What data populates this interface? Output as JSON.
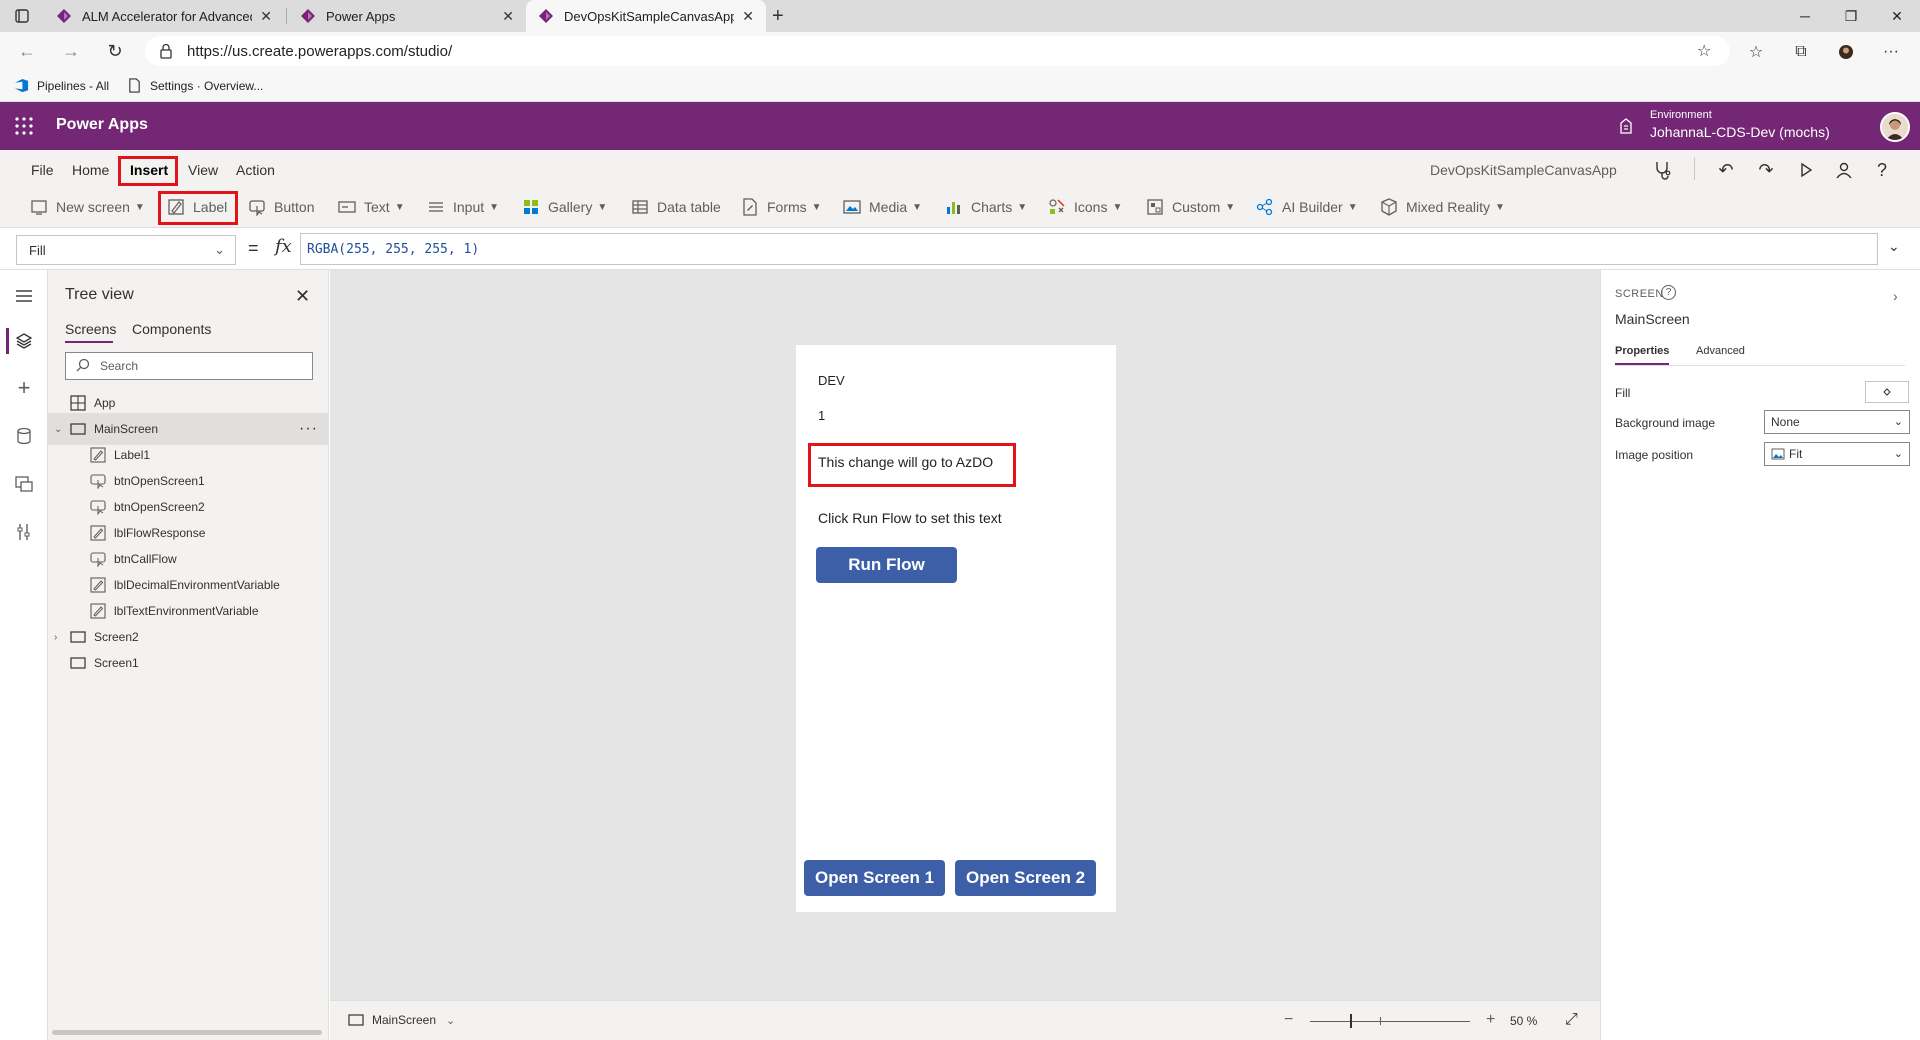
{
  "browser": {
    "tabs": [
      {
        "title": "ALM Accelerator for Advanced M",
        "active": false
      },
      {
        "title": "Power Apps",
        "active": false
      },
      {
        "title": "DevOpsKitSampleCanvasApp - P",
        "active": true
      }
    ],
    "new_tab": "+",
    "url": "https://us.create.powerapps.com/studio/",
    "favorites": [
      {
        "label": "Pipelines - All"
      },
      {
        "label": "Settings · Overview..."
      }
    ]
  },
  "header": {
    "app_name": "Power Apps",
    "environment_label": "Environment",
    "environment_name": "JohannaL-CDS-Dev (mochs)"
  },
  "menu": {
    "items": [
      "File",
      "Home",
      "Insert",
      "View",
      "Action"
    ],
    "selected": "Insert",
    "app_title": "DevOpsKitSampleCanvasApp"
  },
  "ribbon": {
    "new_screen": "New screen",
    "label": "Label",
    "button": "Button",
    "text": "Text",
    "input": "Input",
    "gallery": "Gallery",
    "data_table": "Data table",
    "forms": "Forms",
    "media": "Media",
    "charts": "Charts",
    "icons": "Icons",
    "custom": "Custom",
    "ai_builder": "AI Builder",
    "mixed_reality": "Mixed Reality"
  },
  "formula": {
    "property": "Fill",
    "equals": "=",
    "fx": "fx",
    "value": "RGBA(255, 255, 255, 1)"
  },
  "tree_view": {
    "title": "Tree view",
    "tabs": [
      "Screens",
      "Components"
    ],
    "search_placeholder": "Search",
    "nodes": [
      {
        "label": "App"
      },
      {
        "label": "MainScreen"
      },
      {
        "label": "Label1"
      },
      {
        "label": "btnOpenScreen1"
      },
      {
        "label": "btnOpenScreen2"
      },
      {
        "label": "lblFlowResponse"
      },
      {
        "label": "btnCallFlow"
      },
      {
        "label": "lblDecimalEnvironmentVariable"
      },
      {
        "label": "lblTextEnvironmentVariable"
      },
      {
        "label": "Screen2"
      },
      {
        "label": "Screen1"
      }
    ],
    "more": "···"
  },
  "canvas": {
    "env_text": "DEV",
    "decimal_text": "1",
    "label1_text": "This change will go to AzDO",
    "flow_response_text": "Click Run Flow to set this text",
    "run_flow_button": "Run Flow",
    "open_screen1_button": "Open Screen 1",
    "open_screen2_button": "Open Screen 2"
  },
  "status": {
    "screen": "MainScreen",
    "zoom_minus": "−",
    "zoom_plus": "+",
    "zoom": "50 %",
    "zoom_percent": 50
  },
  "properties": {
    "kind": "SCREEN",
    "help": "?",
    "name": "MainScreen",
    "tabs": [
      "Properties",
      "Advanced"
    ],
    "fill_label": "Fill",
    "background_image_label": "Background image",
    "background_image_value": "None",
    "image_position_label": "Image position",
    "image_position_value": "Fit"
  },
  "colors": {
    "brand": "#742774",
    "button": "#3d5fa8",
    "highlight": "#e0151b"
  }
}
